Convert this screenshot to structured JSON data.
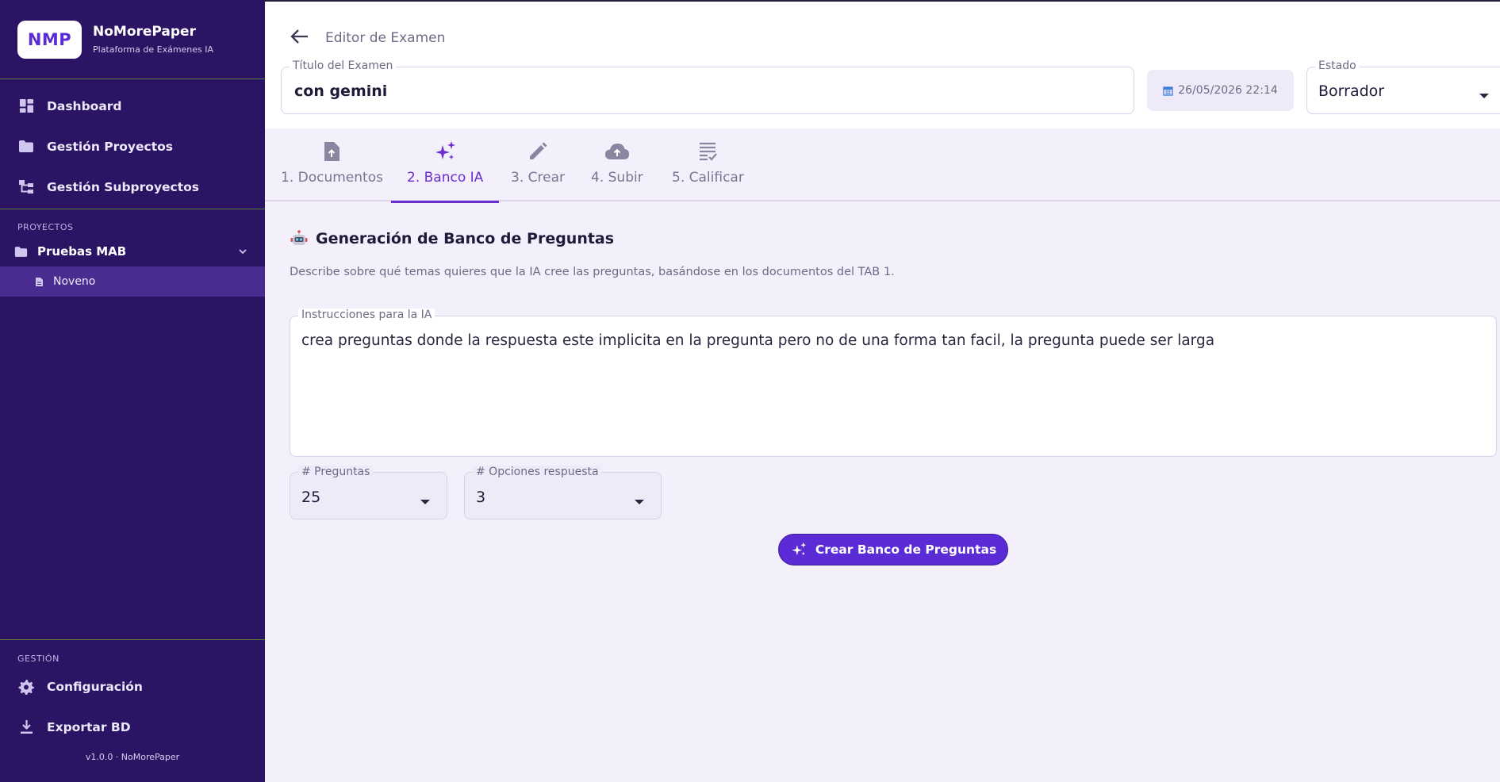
{
  "brand": {
    "logo": "NMP",
    "name": "NoMorePaper",
    "subtitle": "Plataforma de Exámenes IA"
  },
  "nav": {
    "items": [
      {
        "label": "Dashboard",
        "icon": "dashboard-icon"
      },
      {
        "label": "Gestión Proyectos",
        "icon": "folder-icon"
      },
      {
        "label": "Gestión Subproyectos",
        "icon": "tree-icon"
      }
    ]
  },
  "projects": {
    "section_label": "PROYECTOS",
    "project": {
      "label": "Pruebas MAB",
      "icon": "folder-icon"
    },
    "subproject": {
      "label": "Noveno",
      "icon": "document-icon"
    }
  },
  "management": {
    "section_label": "GESTIÓN",
    "items": [
      {
        "label": "Configuración",
        "icon": "gear-icon"
      },
      {
        "label": "Exportar BD",
        "icon": "download-icon"
      }
    ],
    "version": "v1.0.0 · NoMorePaper"
  },
  "header": {
    "back_label": "Editor de Examen",
    "title_label": "Título del Examen",
    "title_value": "con gemini",
    "date": "26/05/2026 22:14",
    "status_label": "Estado",
    "status_value": "Borrador"
  },
  "tabs": [
    {
      "label": "1. Documentos",
      "icon": "file-upload-icon"
    },
    {
      "label": "2. Banco IA",
      "icon": "sparkles-icon",
      "active": true
    },
    {
      "label": "3. Crear",
      "icon": "pencil-icon"
    },
    {
      "label": "4. Subir",
      "icon": "cloud-upload-icon"
    },
    {
      "label": "5. Calificar",
      "icon": "checklist-icon"
    }
  ],
  "bank": {
    "title": "Generación de Banco de Preguntas",
    "description": "Describe sobre qué temas quieres que la IA cree las preguntas, basándose en los documentos del TAB 1.",
    "instructions_label": "Instrucciones para la IA",
    "instructions_value": "crea preguntas donde la respuesta este implicita en la pregunta pero no de una forma tan facil, la pregunta puede ser larga",
    "questions_label": "# Preguntas",
    "questions_value": "25",
    "options_label": "# Opciones respuesta",
    "options_value": "3",
    "create_button": "Crear Banco de Preguntas"
  },
  "colors": {
    "sidebar": "#2a1463",
    "accent": "#5b2bd6",
    "active_tab": "#6a2fd1",
    "background": "#f3effb"
  }
}
